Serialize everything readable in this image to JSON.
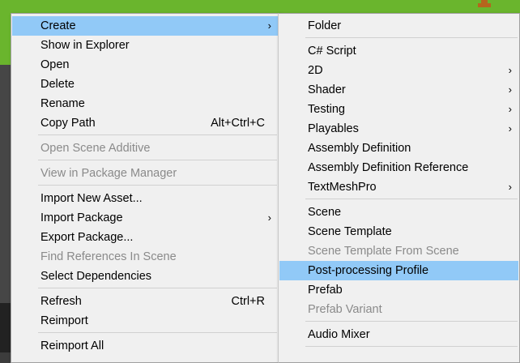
{
  "colors": {
    "accent_highlight": "#91c9f7",
    "topbar_green": "#6ab52d",
    "disabled_text": "#8a8a8a"
  },
  "left_menu": {
    "create": "Create",
    "show_in_explorer": "Show in Explorer",
    "open": "Open",
    "delete": "Delete",
    "rename": "Rename",
    "copy_path": "Copy Path",
    "copy_path_shortcut": "Alt+Ctrl+C",
    "open_scene_additive": "Open Scene Additive",
    "view_in_package_manager": "View in Package Manager",
    "import_new_asset": "Import New Asset...",
    "import_package": "Import Package",
    "export_package": "Export Package...",
    "find_references_in_scene": "Find References In Scene",
    "select_dependencies": "Select Dependencies",
    "refresh": "Refresh",
    "refresh_shortcut": "Ctrl+R",
    "reimport": "Reimport",
    "reimport_all": "Reimport All"
  },
  "right_menu": {
    "folder": "Folder",
    "csharp_script": "C# Script",
    "two_d": "2D",
    "shader": "Shader",
    "testing": "Testing",
    "playables": "Playables",
    "assembly_definition": "Assembly Definition",
    "assembly_definition_reference": "Assembly Definition Reference",
    "textmeshpro": "TextMeshPro",
    "scene": "Scene",
    "scene_template": "Scene Template",
    "scene_template_from_scene": "Scene Template From Scene",
    "post_processing_profile": "Post-processing Profile",
    "prefab": "Prefab",
    "prefab_variant": "Prefab Variant",
    "audio_mixer": "Audio Mixer"
  },
  "arrow_glyph": "›"
}
